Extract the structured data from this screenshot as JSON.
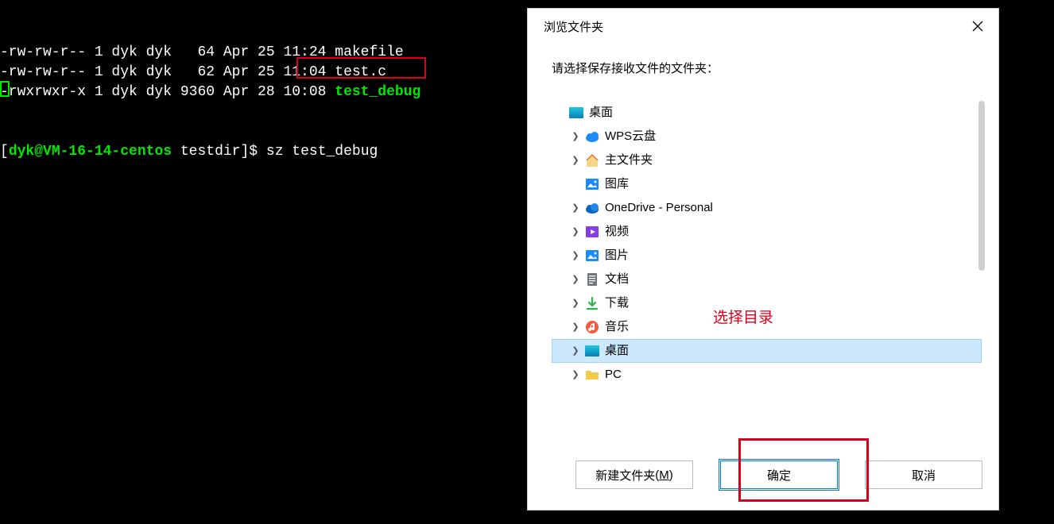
{
  "terminal": {
    "lines": [
      {
        "perm": "-rw-rw-r--",
        "n": "1",
        "u": "dyk",
        "g": "dyk",
        "size": "  64",
        "date": "Apr 25 11:24",
        "name": "makefile",
        "exec": false
      },
      {
        "perm": "-rw-rw-r--",
        "n": "1",
        "u": "dyk",
        "g": "dyk",
        "size": "  62",
        "date": "Apr 25 11:04",
        "name": "test.c",
        "exec": false
      },
      {
        "perm": "-rwxrwxr-x",
        "n": "1",
        "u": "dyk",
        "g": "dyk",
        "size": "9360",
        "date": "Apr 28 10:08",
        "name": "test_debug",
        "exec": true
      }
    ],
    "prompt_user": "dyk@VM-16-14-centos",
    "prompt_path": "testdir",
    "prompt_symbol": "$",
    "command": "sz test_debug"
  },
  "dialog": {
    "title": "浏览文件夹",
    "prompt": "请选择保存接收文件的文件夹：",
    "tree_root": {
      "label": "桌面",
      "icon": "desktop"
    },
    "tree_items": [
      {
        "label": "WPS云盘",
        "icon": "cloud-blue",
        "expandable": true
      },
      {
        "label": "主文件夹",
        "icon": "home",
        "expandable": true
      },
      {
        "label": "图库",
        "icon": "gallery",
        "expandable": false
      },
      {
        "label": "OneDrive - Personal",
        "icon": "cloud-onedrive",
        "expandable": true
      },
      {
        "label": "视频",
        "icon": "video",
        "expandable": true
      },
      {
        "label": "图片",
        "icon": "picture",
        "expandable": true
      },
      {
        "label": "文档",
        "icon": "document",
        "expandable": true
      },
      {
        "label": "下载",
        "icon": "download",
        "expandable": true
      },
      {
        "label": "音乐",
        "icon": "music",
        "expandable": true
      },
      {
        "label": "桌面",
        "icon": "desktop",
        "expandable": true,
        "selected": true
      },
      {
        "label": "PC",
        "icon": "folder",
        "expandable": true
      }
    ],
    "annotation": "选择目录",
    "buttons": {
      "new_folder": "新建文件夹",
      "new_folder_key": "M",
      "ok": "确定",
      "cancel": "取消"
    }
  }
}
